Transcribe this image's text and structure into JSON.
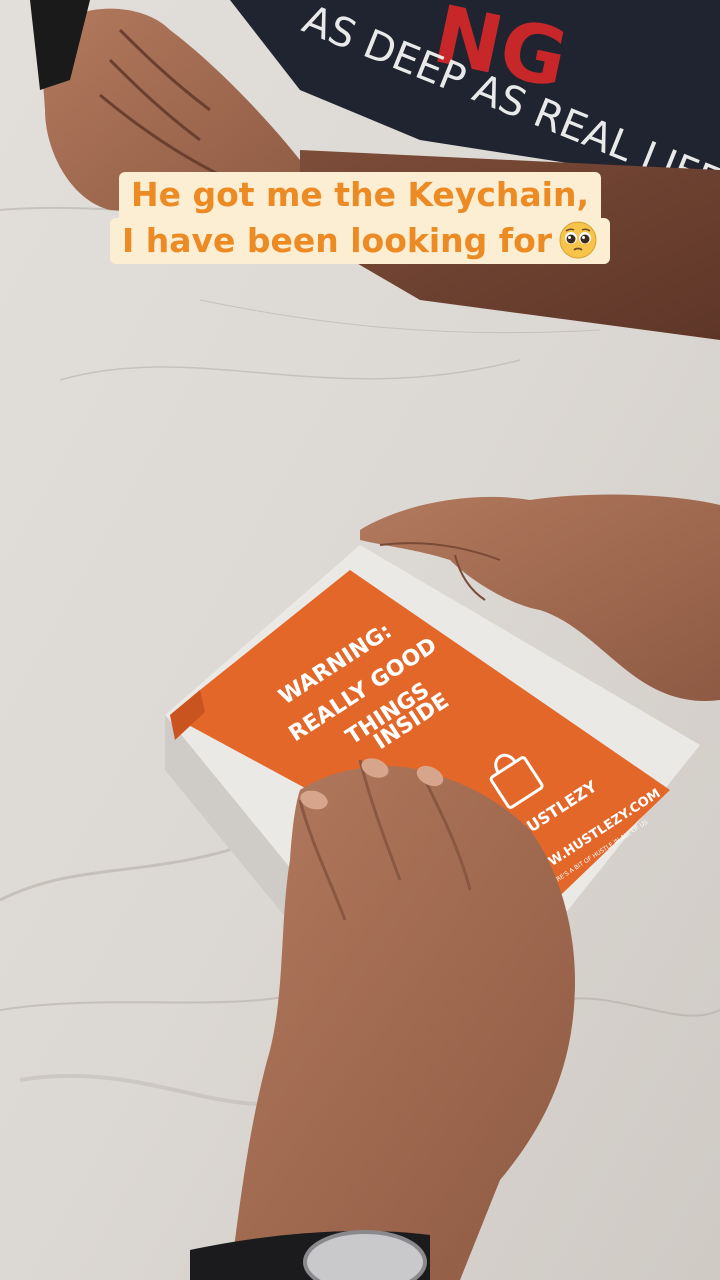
{
  "caption": {
    "line1": "He got me the Keychain,",
    "line2": "I have been looking for",
    "emoji": "pleading-face-emoji"
  },
  "shirt_text": {
    "top": "NG",
    "bottom": "AS DEEP AS REAL LIFE"
  },
  "box_sleeve": {
    "warning": [
      "WARNING:",
      "REALLY GOOD",
      "THINGS",
      "INSIDE"
    ],
    "brand": "HUSTLEZY",
    "url": "WWW.HUSTLEZY.COM",
    "tagline": "THERE'S A BIT OF HUSTLE IN ALL OF US"
  },
  "colors": {
    "caption_bg": "#fbeed3",
    "caption_text": "#ec8a24",
    "sleeve_orange": "#e4672a",
    "shirt": "#1f2430",
    "shirt_red": "#c8272a"
  }
}
